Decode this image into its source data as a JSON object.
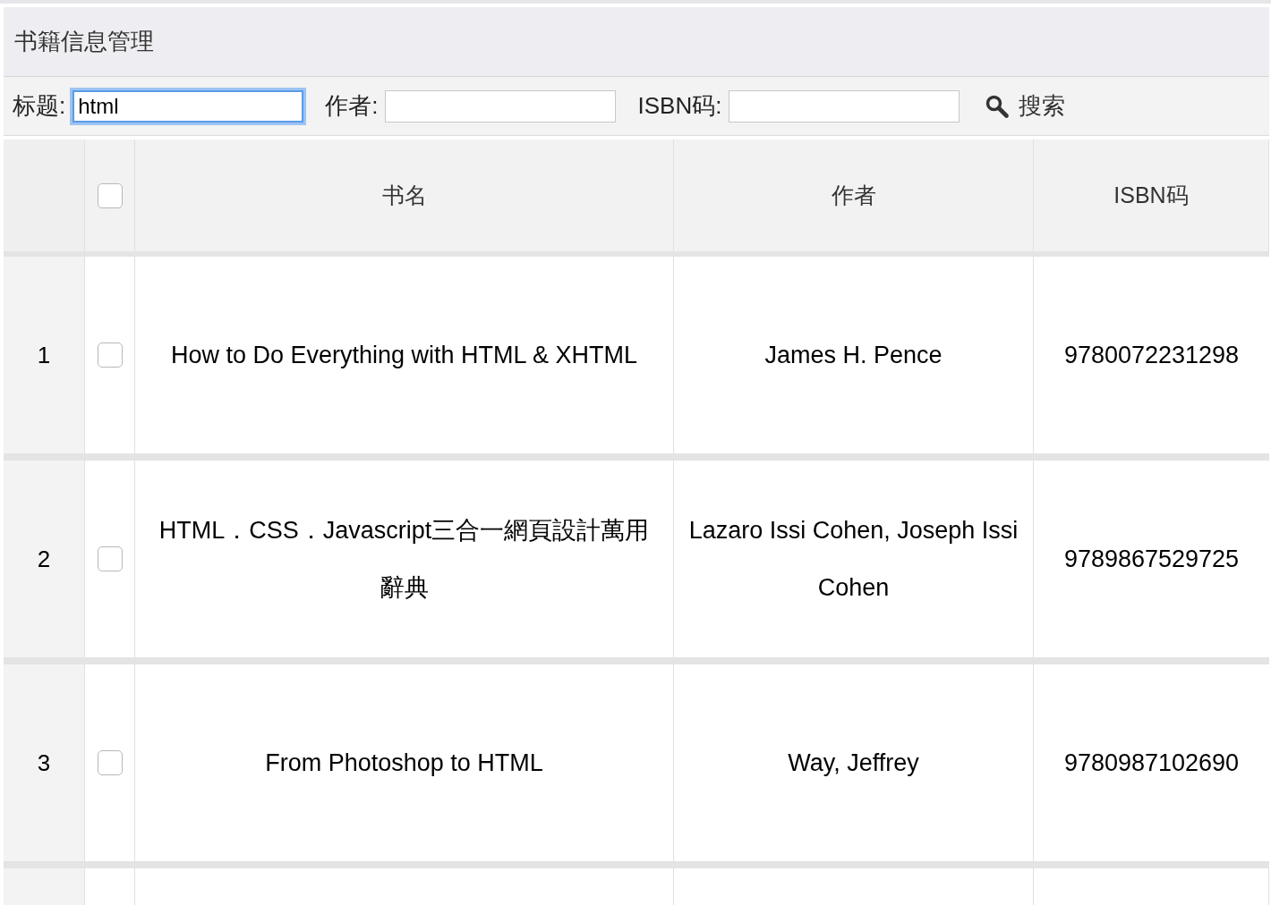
{
  "panel": {
    "title": "书籍信息管理"
  },
  "filters": [
    {
      "label": "标题:",
      "value": "html",
      "focused": true
    },
    {
      "label": "作者:",
      "focused": false
    },
    {
      "label": "ISBN码:",
      "focused": false
    }
  ],
  "search_button": {
    "label": "搜索"
  },
  "table": {
    "header_checked": false,
    "columns": [
      "书名",
      "作者",
      "ISBN码"
    ],
    "rows": [
      {
        "index": "1",
        "checked": false,
        "title": "How to Do Everything with HTML & XHTML",
        "author": "James H. Pence",
        "isbn": "9780072231298"
      },
      {
        "index": "2",
        "checked": false,
        "title": "HTML．CSS．Javascript三合一網頁設計萬用辭典",
        "author": "Lazaro Issi Cohen, Joseph Issi Cohen",
        "isbn": "9789867529725"
      },
      {
        "index": "3",
        "checked": false,
        "title": "From Photoshop to HTML",
        "author": "Way, Jeffrey",
        "isbn": "9780987102690"
      }
    ]
  }
}
